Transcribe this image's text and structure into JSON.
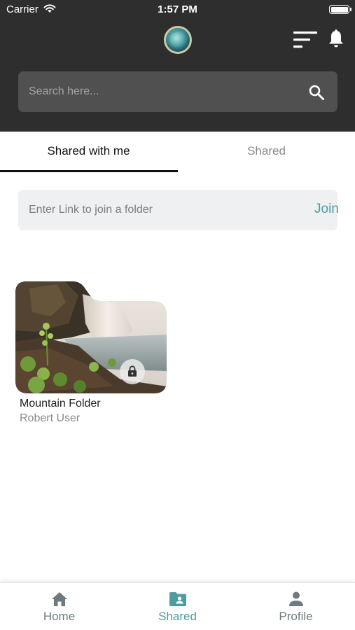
{
  "status_bar": {
    "carrier": "Carrier",
    "time": "1:57 PM"
  },
  "header": {
    "logo_icon": "globe-avatar-icon",
    "filter_icon": "sort-filter-icon",
    "notifications_icon": "bell-icon"
  },
  "search": {
    "placeholder": "Search here...",
    "value": "",
    "icon": "search-icon"
  },
  "tabs": [
    {
      "label": "Shared with me",
      "active": true
    },
    {
      "label": "Shared",
      "active": false
    }
  ],
  "join": {
    "placeholder": "Enter Link to join a folder",
    "value": "",
    "button_label": "Join"
  },
  "folders": [
    {
      "name": "Mountain Folder",
      "owner": "Robert User",
      "locked": true,
      "thumbnail": "waterfall-landscape"
    }
  ],
  "bottom_nav": [
    {
      "label": "Home",
      "icon": "home-icon",
      "active": false
    },
    {
      "label": "Shared",
      "icon": "shared-folder-icon",
      "active": true
    },
    {
      "label": "Profile",
      "icon": "person-icon",
      "active": false
    }
  ],
  "colors": {
    "header_bg": "#2e2e2e",
    "search_bg": "#505050",
    "accent": "#4e9ca1",
    "join_bg": "#eef0f1",
    "inactive_nav": "#6f7a80"
  }
}
